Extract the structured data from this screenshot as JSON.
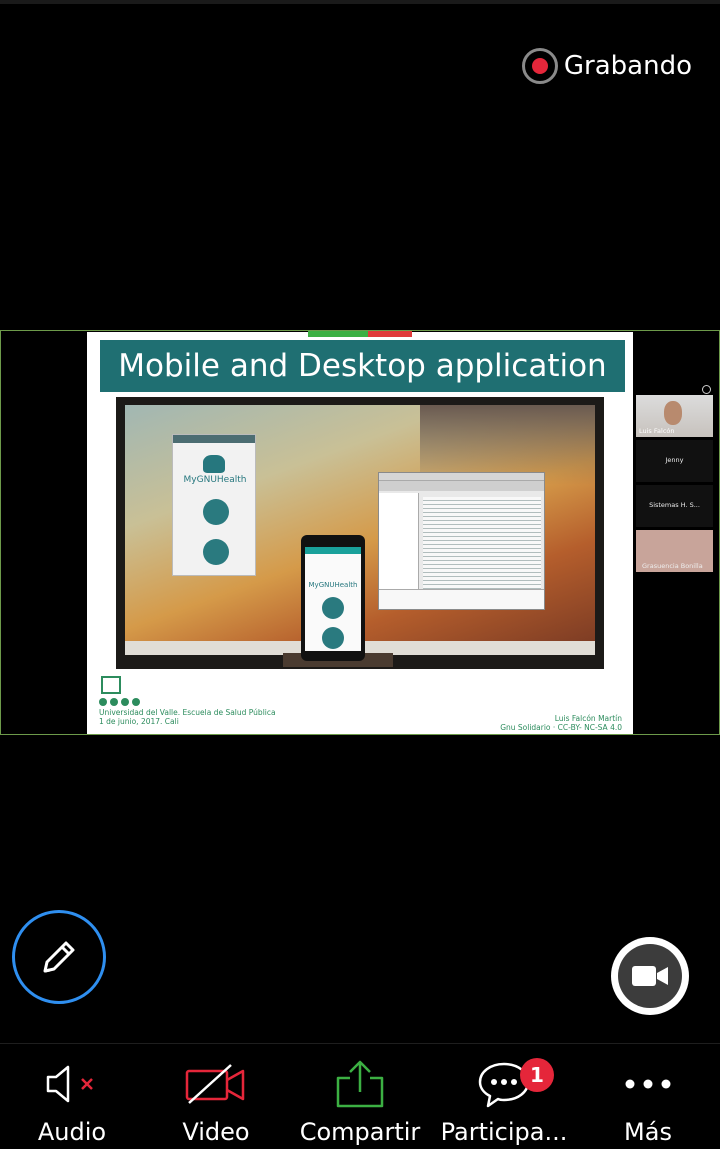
{
  "recording": {
    "label": "Grabando",
    "color": "#e5263a"
  },
  "share_indicator": {
    "stop_color": "#e03a3a",
    "active_color": "#3cb043"
  },
  "slide": {
    "title": "Mobile and Desktop application",
    "app_brand": "MyGNUHealth",
    "footer_left_line1": "Universidad del Valle. Escuela de Salud Pública",
    "footer_left_line2": "1 de junio, 2017. Cali",
    "footer_right_line1": "Luis Falcón Martín",
    "footer_right_line2": "Gnu Solidario · CC-BY- NC-SA 4.0"
  },
  "participants": [
    {
      "name": "Luis Falcón",
      "type": "video"
    },
    {
      "name": "Jenny",
      "type": "name"
    },
    {
      "name": "Sistemas H. S...",
      "type": "name"
    },
    {
      "name": "Grasuencia Bonilla",
      "type": "video"
    }
  ],
  "toolbar": {
    "audio_label": "Audio",
    "video_label": "Video",
    "share_label": "Compartir",
    "participants_label": "Participa...",
    "participants_badge": "1",
    "more_label": "Más",
    "share_icon_color": "#3cb043",
    "muted_color": "#e5263a"
  },
  "icons": {
    "annotate": "pencil-icon",
    "camera_switch": "camera-icon",
    "audio": "speaker-muted-icon",
    "video": "video-off-icon",
    "share": "share-upload-icon",
    "chat": "chat-bubble-icon",
    "more": "more-dots-icon"
  }
}
